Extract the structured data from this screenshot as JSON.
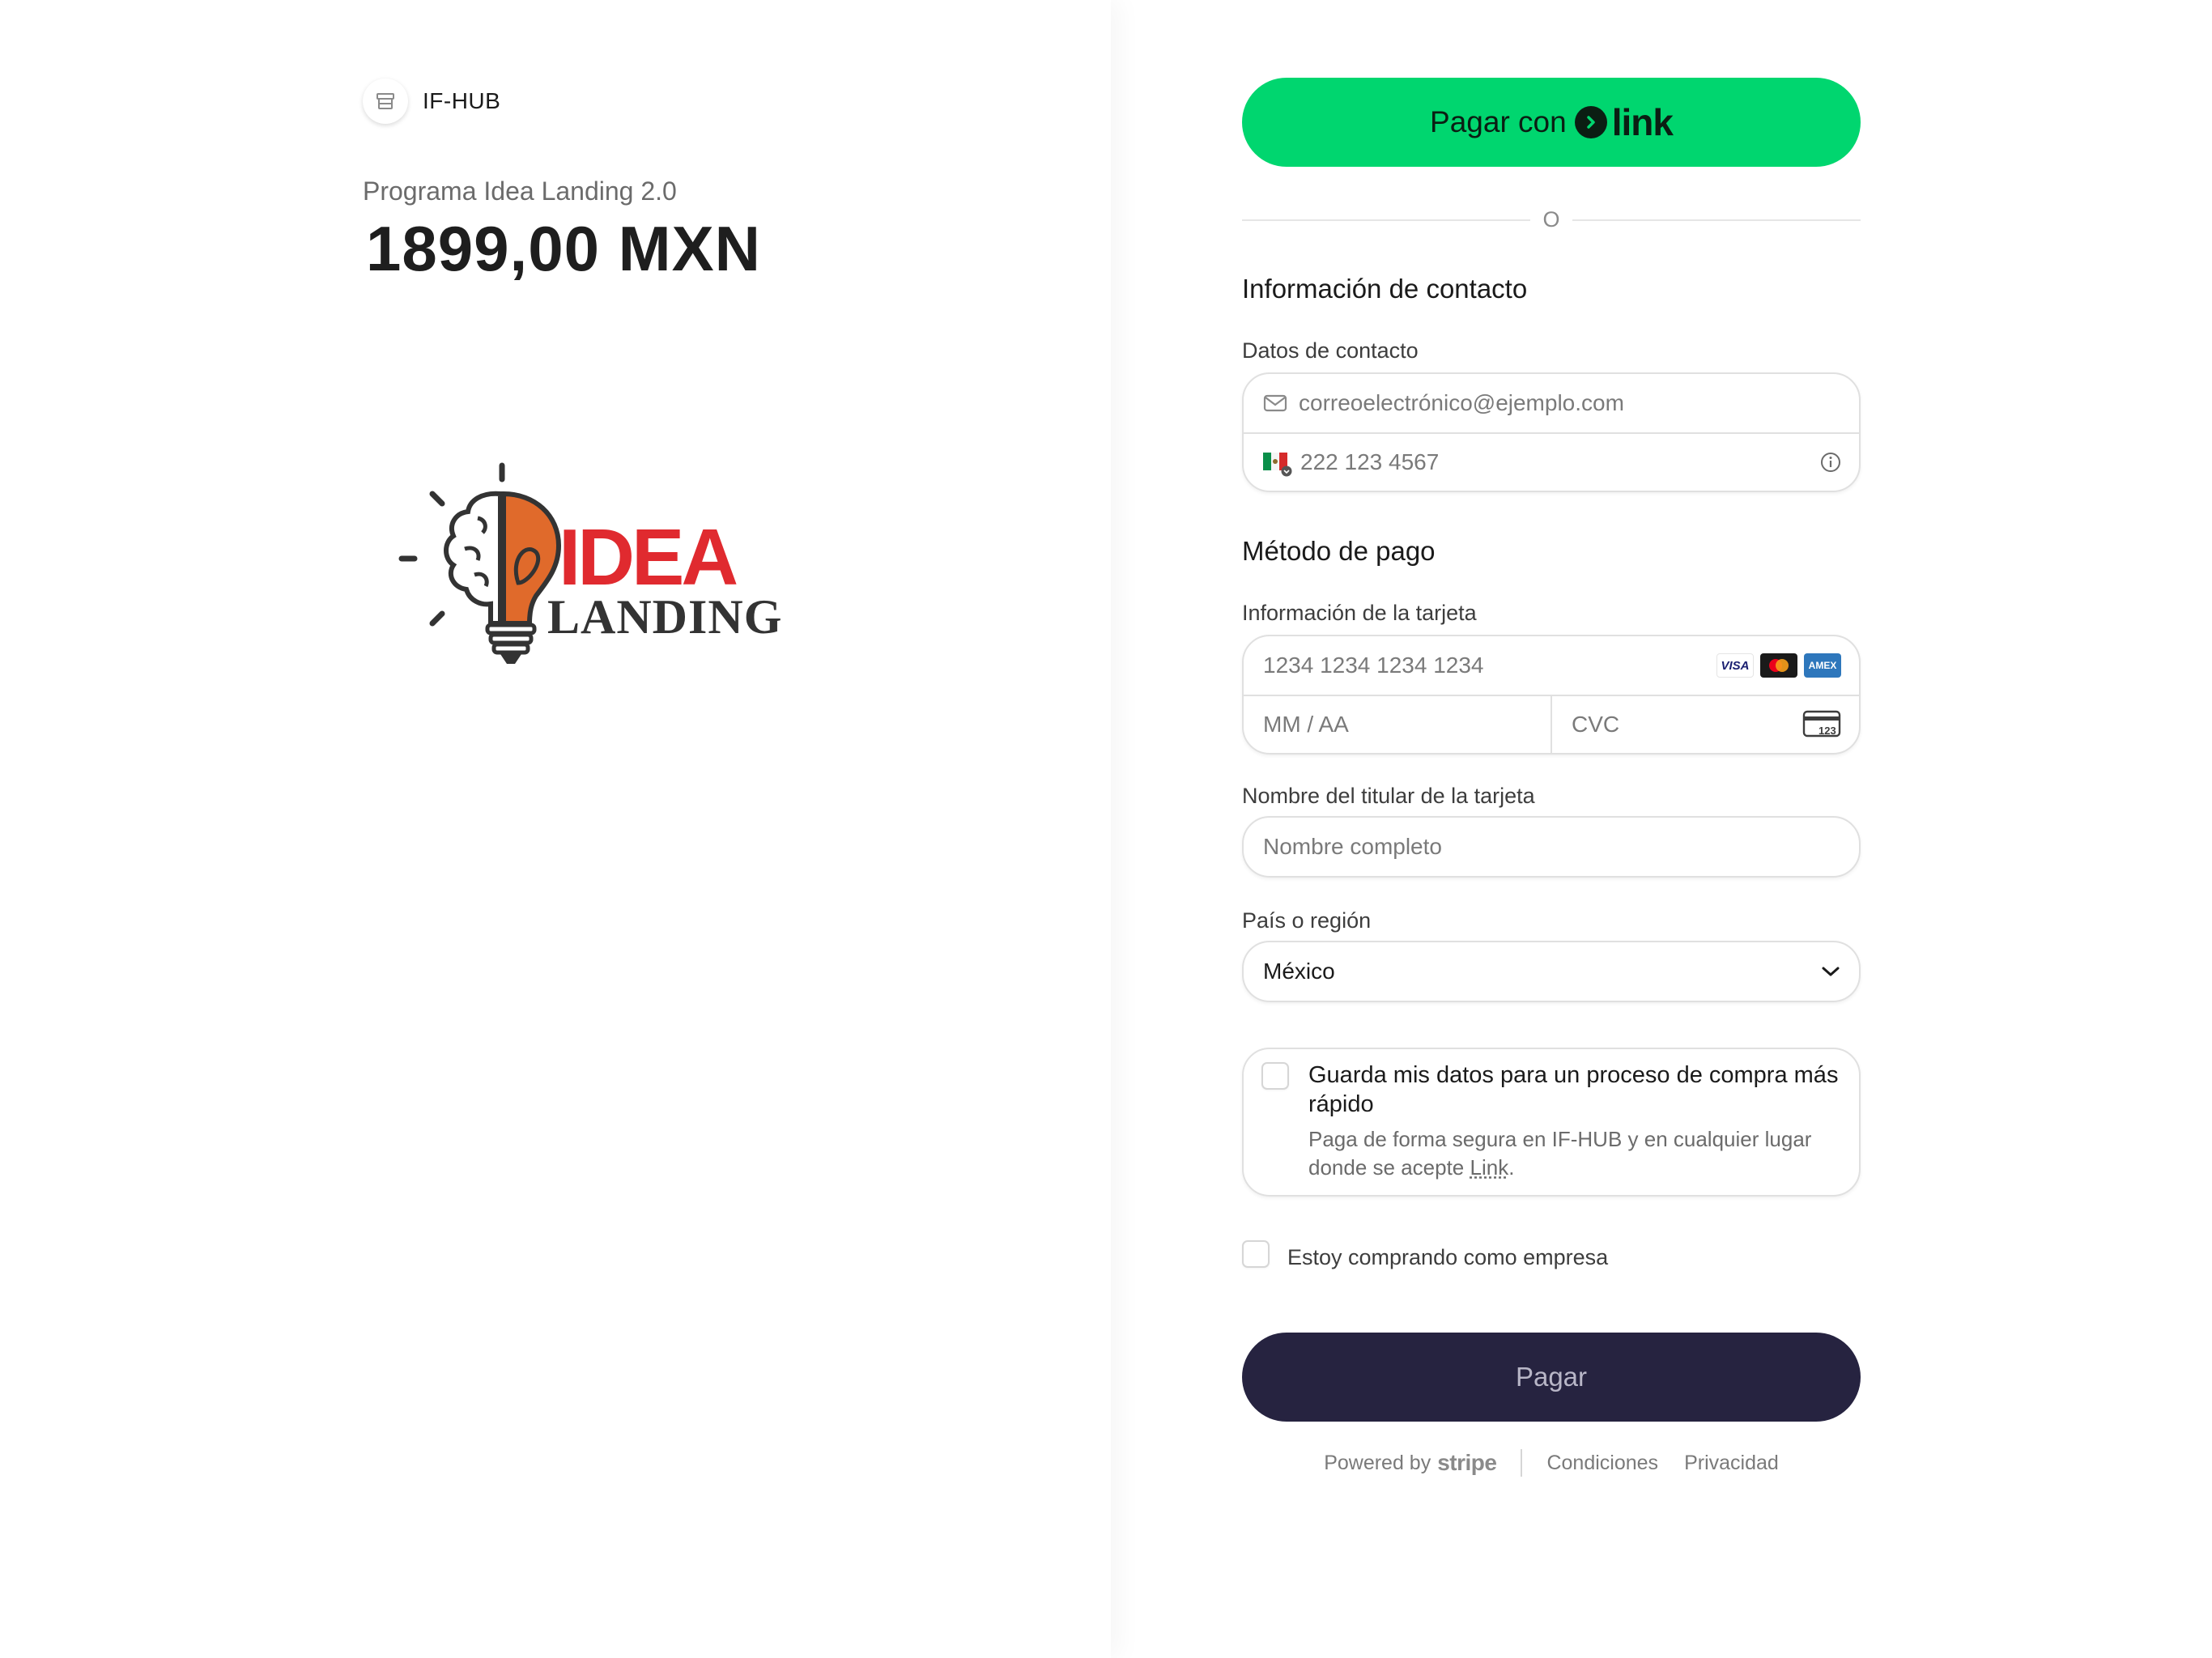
{
  "merchant": {
    "name": "IF-HUB"
  },
  "product": {
    "name": "Programa Idea Landing 2.0",
    "price": "1899,00 MXN"
  },
  "logo": {
    "word_top": "IDEA",
    "word_bottom": "LANDING"
  },
  "link_button": {
    "label": "Pagar con",
    "brand": "link"
  },
  "divider": {
    "text": "O"
  },
  "contact": {
    "title": "Información de contacto",
    "label": "Datos de contacto",
    "email_placeholder": "correoelectrónico@ejemplo.com",
    "phone_placeholder": "222 123 4567"
  },
  "payment": {
    "title": "Método de pago",
    "card_label": "Información de la tarjeta",
    "card_number_placeholder": "1234 1234 1234 1234",
    "expiry_placeholder": "MM / AA",
    "cvc_placeholder": "CVC",
    "cvc_icon_text": "123",
    "brands": [
      "VISA",
      "mastercard",
      "AMEX"
    ]
  },
  "cardholder": {
    "label": "Nombre del titular de la tarjeta",
    "placeholder": "Nombre completo"
  },
  "country": {
    "label": "País o región",
    "value": "México"
  },
  "save": {
    "title": "Guarda mis datos para un proceso de compra más rápido",
    "desc_prefix": "Paga de forma segura en IF-HUB y en cualquier lugar donde se acepte ",
    "desc_link": "Link",
    "desc_suffix": "."
  },
  "business": {
    "label": "Estoy comprando como empresa"
  },
  "pay_button": {
    "label": "Pagar"
  },
  "footer": {
    "powered_by": "Powered by",
    "stripe": "stripe",
    "terms": "Condiciones",
    "privacy": "Privacidad"
  },
  "colors": {
    "link_green": "#00d66f",
    "pay_button": "#262340",
    "logo_red": "#e02a2f",
    "logo_orange": "#e06a2b"
  }
}
